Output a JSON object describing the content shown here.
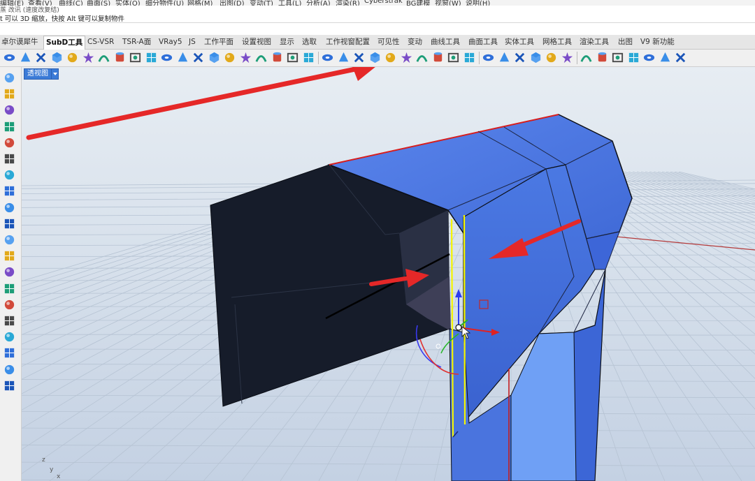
{
  "menu": {
    "items": [
      "编辑(E)",
      "查看(V)",
      "曲线(C)",
      "曲面(S)",
      "实体(O)",
      "细分物件(U)",
      "网格(M)",
      "出图(D)",
      "变动(T)",
      "工具(L)",
      "分析(A)",
      "渲染(R)",
      "Cyberstrak",
      "BG建模",
      "视窗(W)",
      "说明(H)"
    ]
  },
  "command": {
    "history_line": "蒸 改讯 (速度改复结)",
    "prompt": "t 可以 3D 缩放，快按 Alt 键可以复制物件"
  },
  "tabs": {
    "items": [
      "卓尔谟犀牛",
      "SubD工具",
      "CS-VSR",
      "TSR-A面",
      "VRay5",
      "JS",
      "工作平面",
      "设置视图",
      "显示",
      "选取",
      "工作视窗配置",
      "可见性",
      "变动",
      "曲线工具",
      "曲面工具",
      "实体工具",
      "网格工具",
      "渲染工具",
      "出图",
      "V9 新功能"
    ],
    "active": "SubD工具"
  },
  "toolbar": {
    "icons": [
      "cone-icon",
      "paraboloid-icon",
      "cylinder-icon",
      "sphere-icon",
      "ellipsoid-icon",
      "torus-icon",
      "cube-icon",
      "pipe-icon",
      "loft-icon",
      "sweep-icon",
      "revolve-icon",
      "patch-icon",
      "bridge-icon",
      "crease-icon",
      "insert-edge-icon",
      "offset-icon",
      "mirror-icon",
      "bevel-icon",
      "fill-icon",
      "slide-icon",
      "weld-icon",
      "star-icon",
      "subd-cube-icon",
      "merge-icon",
      "extract-icon",
      "stitch-icon",
      "symmetry-icon",
      "subd-sphere-icon",
      "box-frame-icon",
      "select-loop-icon",
      "lattice-icon",
      "convert-icon",
      "subd-display-icon",
      "smooth-icon",
      "split-icon",
      "match-icon",
      "settings-icon",
      "gear-icon",
      "object-icon",
      "color-icon",
      "bulb-icon",
      "no-icon",
      "layers-icon"
    ]
  },
  "left_toolbar": {
    "icons": [
      "pointer-icon",
      "orbit-icon",
      "circle-icon",
      "extrude-icon",
      "cylinder-tool-icon",
      "blend-icon",
      "cluster-icon",
      "arc-icon",
      "point-icon",
      "box-tool-icon",
      "cube-tool-icon",
      "mirror-tool-icon",
      "align-icon",
      "green-man-icon",
      "cross-icon",
      "save-icon",
      "radial-icon",
      "paint-icon",
      "number-3-icon",
      "grid-icon"
    ]
  },
  "viewport": {
    "label": "透视图",
    "axis_x": "x",
    "axis_y": "y",
    "axis_z": "z",
    "colors": {
      "model_blue": "#4a77e0",
      "model_dark": "#141a28",
      "edge_selected": "#f2f200",
      "arrow_red": "#e52828",
      "grid_line": "#b9c5d4"
    }
  }
}
